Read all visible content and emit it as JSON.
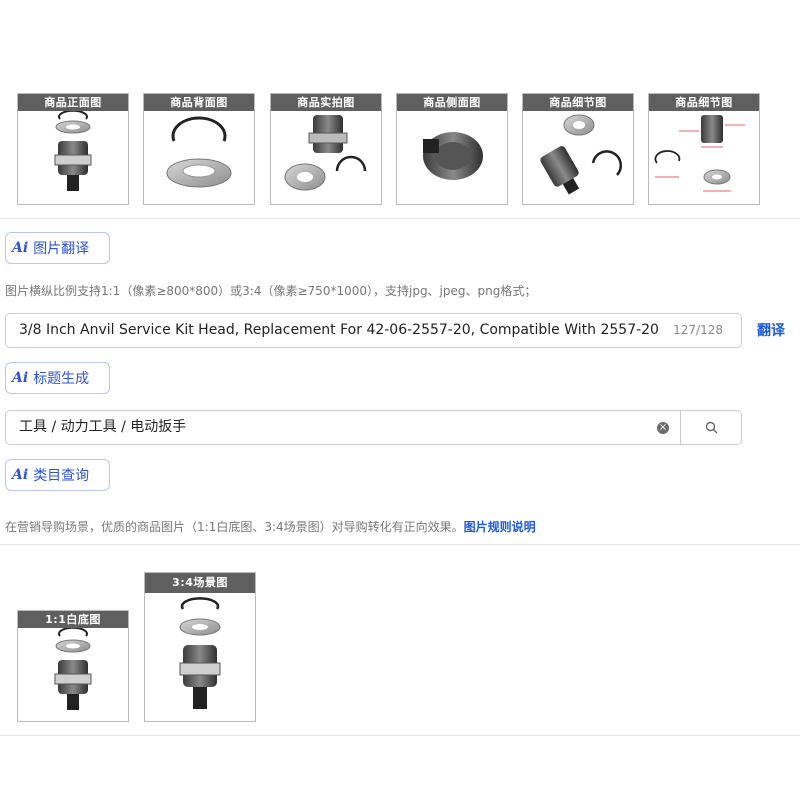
{
  "thumbnails": [
    {
      "label": "商品正面图"
    },
    {
      "label": "商品背面图"
    },
    {
      "label": "商品实拍图"
    },
    {
      "label": "商品侧面图"
    },
    {
      "label": "商品细节图"
    },
    {
      "label": "商品细节图"
    }
  ],
  "image_translate": {
    "logo": "Ai",
    "label": "图片翻译"
  },
  "image_hint": "图片横纵比例支持1:1（像素≥800*800）或3:4（像素≥750*1000），支持jpg、jpeg、png格式；",
  "title_field": {
    "value": "3/8 Inch Anvil Service Kit Head, Replacement For 42-06-2557-20, Compatible With 2557-20",
    "counter": "127/128",
    "translate_label": "翻译"
  },
  "title_generate": {
    "logo": "Ai",
    "label": "标题生成"
  },
  "category_field": {
    "value": "工具 / 动力工具 / 电动扳手"
  },
  "category_query": {
    "logo": "Ai",
    "label": "类目查询"
  },
  "marketing_hint": {
    "text": "在营销导购场景，优质的商品图片（1:1白底图、3:4场景图）对导购转化有正向效果。",
    "link": "图片规则说明"
  },
  "marketing_images": [
    {
      "label": "1:1白底图"
    },
    {
      "label": "3:4场景图"
    }
  ],
  "colors": {
    "accent": "#2f53d6",
    "link": "#1e5bd8",
    "label_bg": "#5f5f5f"
  }
}
